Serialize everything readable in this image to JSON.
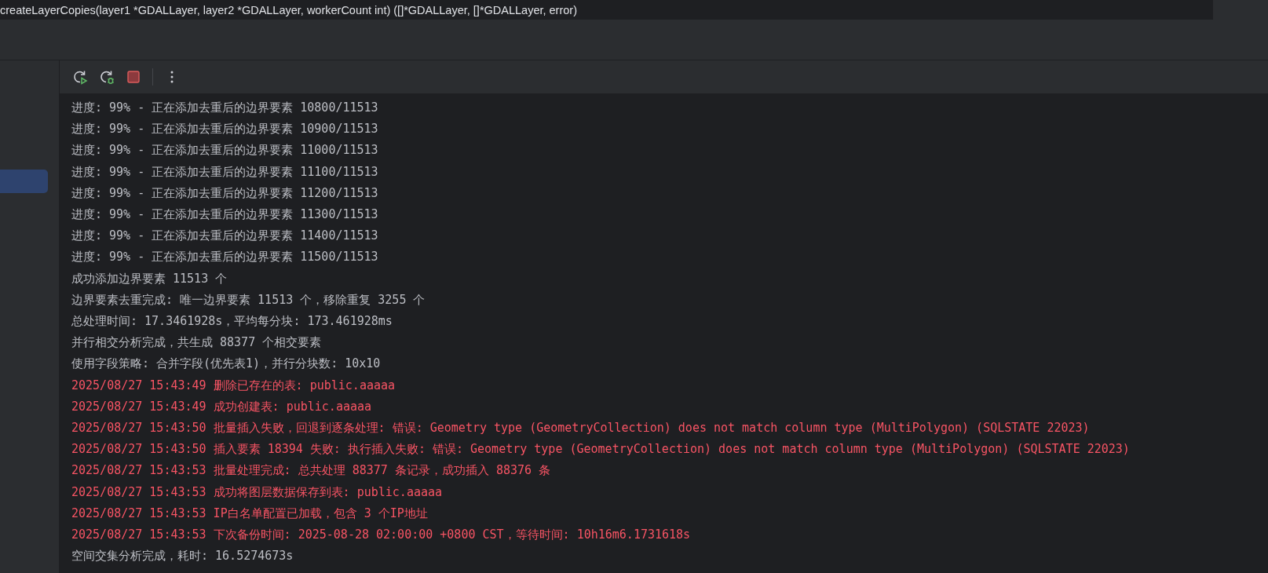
{
  "editor_breadcrumb": {
    "text": "createLayerCopies(layer1 *GDALLayer, layer2 *GDALLayer, workerCount int) ([]*GDALLayer, []*GDALLayer, error)"
  },
  "console": {
    "lines": [
      {
        "kind": "normal",
        "text": "进度: 99% - 正在添加去重后的边界要素 10800/11513"
      },
      {
        "kind": "normal",
        "text": "进度: 99% - 正在添加去重后的边界要素 10900/11513"
      },
      {
        "kind": "normal",
        "text": "进度: 99% - 正在添加去重后的边界要素 11000/11513"
      },
      {
        "kind": "normal",
        "text": "进度: 99% - 正在添加去重后的边界要素 11100/11513"
      },
      {
        "kind": "normal",
        "text": "进度: 99% - 正在添加去重后的边界要素 11200/11513"
      },
      {
        "kind": "normal",
        "text": "进度: 99% - 正在添加去重后的边界要素 11300/11513"
      },
      {
        "kind": "normal",
        "text": "进度: 99% - 正在添加去重后的边界要素 11400/11513"
      },
      {
        "kind": "normal",
        "text": "进度: 99% - 正在添加去重后的边界要素 11500/11513"
      },
      {
        "kind": "normal",
        "text": "成功添加边界要素 11513 个"
      },
      {
        "kind": "normal",
        "text": "边界要素去重完成: 唯一边界要素 11513 个，移除重复 3255 个"
      },
      {
        "kind": "normal",
        "text": "总处理时间: 17.3461928s，平均每分块: 173.461928ms"
      },
      {
        "kind": "normal",
        "text": "并行相交分析完成，共生成 88377 个相交要素"
      },
      {
        "kind": "normal",
        "text": "使用字段策略: 合并字段(优先表1)，并行分块数: 10x10"
      },
      {
        "kind": "error",
        "text": "2025/08/27 15:43:49 删除已存在的表: public.aaaaa"
      },
      {
        "kind": "error",
        "text": "2025/08/27 15:43:49 成功创建表: public.aaaaa"
      },
      {
        "kind": "error",
        "text": "2025/08/27 15:43:50 批量插入失败，回退到逐条处理: 错误: Geometry type (GeometryCollection) does not match column type (MultiPolygon) (SQLSTATE 22023)"
      },
      {
        "kind": "error",
        "text": "2025/08/27 15:43:50 插入要素 18394 失败: 执行插入失败: 错误: Geometry type (GeometryCollection) does not match column type (MultiPolygon) (SQLSTATE 22023)"
      },
      {
        "kind": "error",
        "text": "2025/08/27 15:43:53 批量处理完成: 总共处理 88377 条记录，成功插入 88376 条"
      },
      {
        "kind": "error",
        "text": "2025/08/27 15:43:53 成功将图层数据保存到表: public.aaaaa"
      },
      {
        "kind": "error",
        "text": "2025/08/27 15:43:53 IP白名单配置已加载，包含 3 个IP地址"
      },
      {
        "kind": "error",
        "text": "2025/08/27 15:43:53 下次备份时间: 2025-08-28 02:00:00 +0800 CST，等待时间: 10h16m6.1731618s"
      },
      {
        "kind": "normal",
        "text": "空间交集分析完成，耗时: 16.5274673s"
      }
    ]
  }
}
